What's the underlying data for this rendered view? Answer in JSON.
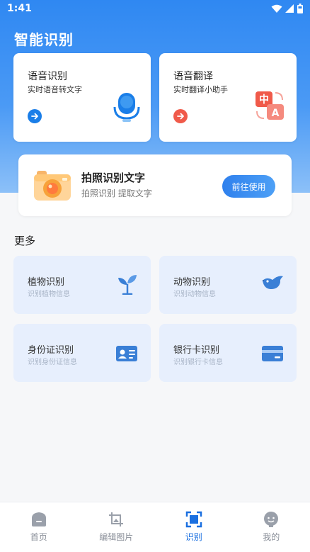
{
  "status_bar": {
    "time": "1:41"
  },
  "header": {
    "title": "智能识别"
  },
  "feature_cards": [
    {
      "title": "语音识别",
      "subtitle": "实时语音转文字",
      "icon": "microphone-icon",
      "accent": "#1a7ee8"
    },
    {
      "title": "语音翻译",
      "subtitle": "实时翻译小助手",
      "icon": "translate-icon",
      "accent": "#f05a4a",
      "icon_glyphs": [
        "中",
        "A"
      ]
    }
  ],
  "photo_card": {
    "title": "拍照识别文字",
    "subtitle": "拍照识别 提取文字",
    "button_label": "前往使用",
    "icon": "camera-icon"
  },
  "more_section": {
    "title": "更多",
    "items": [
      {
        "title": "植物识别",
        "subtitle": "识别植物信息",
        "icon": "plant-icon"
      },
      {
        "title": "动物识别",
        "subtitle": "识别动物信息",
        "icon": "bird-icon"
      },
      {
        "title": "身份证识别",
        "subtitle": "识别身份证信息",
        "icon": "id-card-icon"
      },
      {
        "title": "银行卡识别",
        "subtitle": "识别银行卡信息",
        "icon": "bank-card-icon"
      }
    ]
  },
  "tab_bar": {
    "active_index": 2,
    "items": [
      {
        "label": "首页",
        "icon": "home-icon"
      },
      {
        "label": "编辑图片",
        "icon": "edit-image-icon"
      },
      {
        "label": "识别",
        "icon": "scan-icon"
      },
      {
        "label": "我的",
        "icon": "profile-icon"
      }
    ]
  },
  "colors": {
    "primary": "#2f88f2",
    "tile_bg": "#e7effd",
    "active_tab": "#1a6fe0",
    "inactive_tab": "#8a8f99"
  }
}
